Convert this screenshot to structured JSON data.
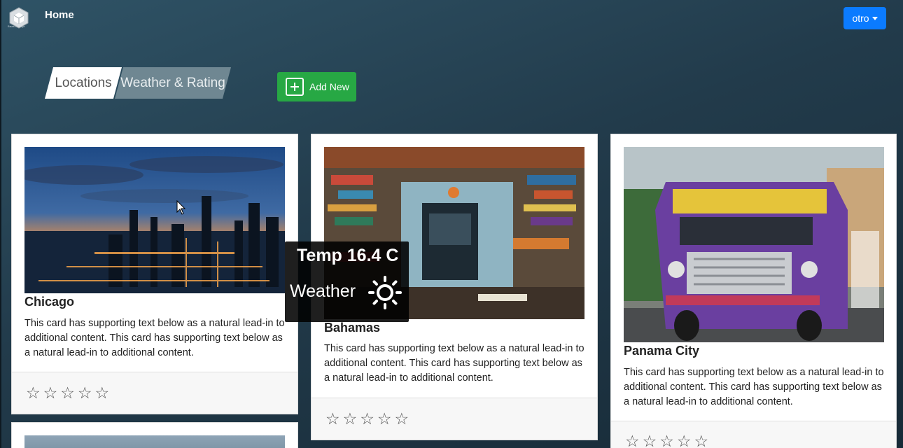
{
  "nav": {
    "home_label": "Home",
    "logo_text": "Baas Luhaja",
    "user_menu_label": "otro"
  },
  "tabs": [
    {
      "label": "Locations",
      "active": true
    },
    {
      "label": "Weather & Rating",
      "active": false
    }
  ],
  "add_button_label": "Add New",
  "cards": [
    {
      "title": "Chicago",
      "text": "This card has supporting text below as a natural lead-in to additional content. This card has supporting text below as a natural lead-in to additional content.",
      "rating": 0,
      "max_rating": 5
    },
    {
      "title": "Bahamas",
      "text": "This card has supporting text below as a natural lead-in to additional content. This card has supporting text below as a natural lead-in to additional content.",
      "rating": 0,
      "max_rating": 5
    },
    {
      "title": "Panama City",
      "text": "This card has supporting text below as a natural lead-in to additional content. This card has supporting text below as a natural lead-in to additional content.",
      "rating": 0,
      "max_rating": 5
    }
  ],
  "tooltip": {
    "temp_label": "Temp 16.4 C",
    "weather_label": "Weather",
    "weather_icon": "sun-icon"
  },
  "colors": {
    "primary": "#0b7bff",
    "success": "#27a844"
  }
}
